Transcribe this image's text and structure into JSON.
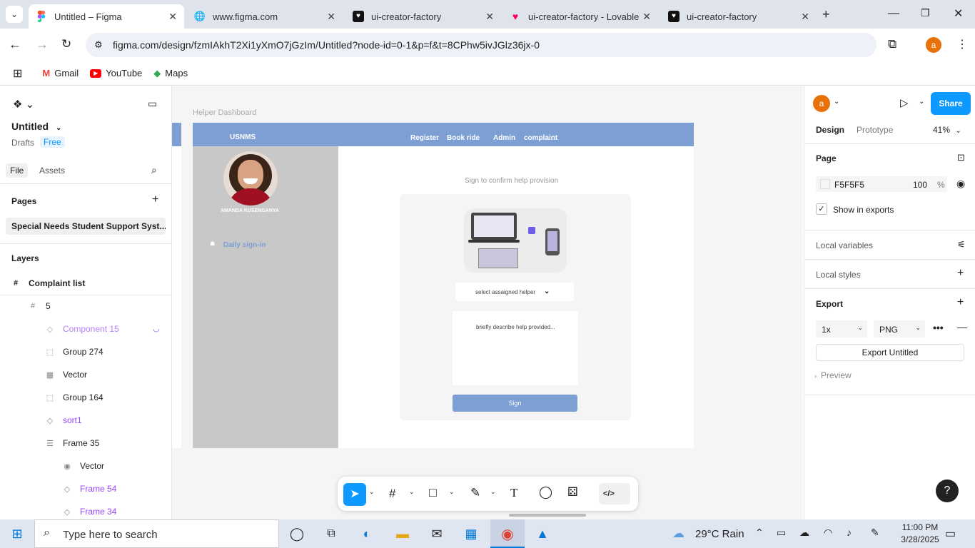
{
  "browser": {
    "tabs": [
      {
        "title": "Untitled – Figma",
        "active": true
      },
      {
        "title": "www.figma.com",
        "active": false
      },
      {
        "title": "ui-creator-factory",
        "active": false
      },
      {
        "title": "ui-creator-factory - Lovable",
        "active": false
      },
      {
        "title": "ui-creator-factory",
        "active": false
      }
    ],
    "url": "figma.com/design/fzmIAkhT2Xi1yXmO7jGzIm/Untitled?node-id=0-1&p=f&t=8CPhw5ivJGlz36jx-0",
    "profile_initial": "a",
    "bookmarks": [
      "Gmail",
      "YouTube",
      "Maps"
    ]
  },
  "left": {
    "file_title": "Untitled",
    "drafts": "Drafts",
    "plan": "Free",
    "tabs": [
      "File",
      "Assets"
    ],
    "pages_label": "Pages",
    "page_item": "Special Needs Student Support Syst...",
    "layers_label": "Layers",
    "layers": [
      {
        "name": "Complaint list",
        "icon": "frame-icon"
      },
      {
        "name": "5",
        "icon": "frame-icon"
      },
      {
        "name": "Component 15",
        "icon": "component-icon"
      },
      {
        "name": "Group 274",
        "icon": "group-icon"
      },
      {
        "name": "Vector",
        "icon": "vector-icon"
      },
      {
        "name": "Group 164",
        "icon": "group-icon"
      },
      {
        "name": "sort1",
        "icon": "component-icon"
      },
      {
        "name": "Frame 35",
        "icon": "auto-layout-icon"
      },
      {
        "name": "Vector",
        "icon": "eye-icon"
      },
      {
        "name": "Frame 54",
        "icon": "component-icon"
      },
      {
        "name": "Frame 34",
        "icon": "component-icon"
      }
    ]
  },
  "canvas": {
    "frame_label": "Helper Dashboard",
    "nav_brand": "USNMS",
    "nav_links": [
      "Register",
      "Book ride",
      "Admin",
      "complaint"
    ],
    "user_name": "AMANDA KUSENGANYA",
    "sidebar_item": "Daily sign-in",
    "heading": "Sign to confirm help provision",
    "select_label": "select assaigned helper",
    "textarea_placeholder": "briefly describe help provided...",
    "sign_button": "Sign"
  },
  "right": {
    "user_initial": "a",
    "share": "Share",
    "tabs": [
      "Design",
      "Prototype"
    ],
    "zoom": "41%",
    "page_label": "Page",
    "page_color": "F5F5F5",
    "page_opacity": "100",
    "percent": "%",
    "show_in_exports": "Show in exports",
    "local_variables": "Local variables",
    "local_styles": "Local styles",
    "export_label": "Export",
    "export_scale": "1x",
    "export_format": "PNG",
    "export_button": "Export Untitled",
    "preview": "Preview"
  },
  "taskbar": {
    "search_placeholder": "Type here to search",
    "weather": "29°C  Rain",
    "time": "11:00 PM",
    "date": "3/28/2025"
  },
  "colors": {
    "accent": "#0d99ff",
    "nav_bar": "#7d9fd3",
    "sidebar_gray": "#c8c8c8",
    "purple": "#9747ff"
  }
}
